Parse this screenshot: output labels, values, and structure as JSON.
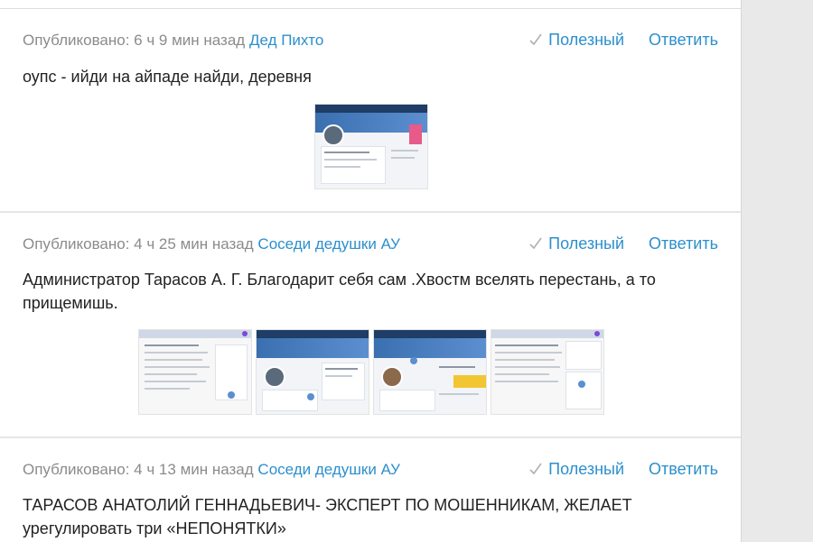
{
  "posts": [
    {
      "meta_prefix": "Опубликовано: 6 ч 9 мин назад",
      "author": "Дед Пихто",
      "useful_label": "Полезный",
      "reply_label": "Ответить",
      "text": "оупс - ийди на айпаде найди, деревня"
    },
    {
      "meta_prefix": "Опубликовано: 4 ч 25 мин назад",
      "author": "Соседи дедушки АУ",
      "useful_label": "Полезный",
      "reply_label": "Ответить",
      "text": "Администратор Тарасов А. Г. Благодарит себя сам .Хвостм вселять перестань, а то прищемишь."
    },
    {
      "meta_prefix": "Опубликовано: 4 ч 13 мин назад",
      "author": "Соседи дедушки АУ",
      "useful_label": "Полезный",
      "reply_label": "Ответить",
      "text": "ТАРАСОВ АНАТОЛИЙ ГЕННАДЬЕВИЧ- ЭКСПЕРТ ПО МОШЕННИКАМ, ЖЕЛАЕТ урегулировать три «НЕПОНЯТКИ»"
    }
  ],
  "colors": {
    "link": "#2c8fcc",
    "meta": "#8b8b8b",
    "text": "#222222",
    "background": "#e9e9e9"
  },
  "icons": {
    "useful": "check-icon"
  }
}
